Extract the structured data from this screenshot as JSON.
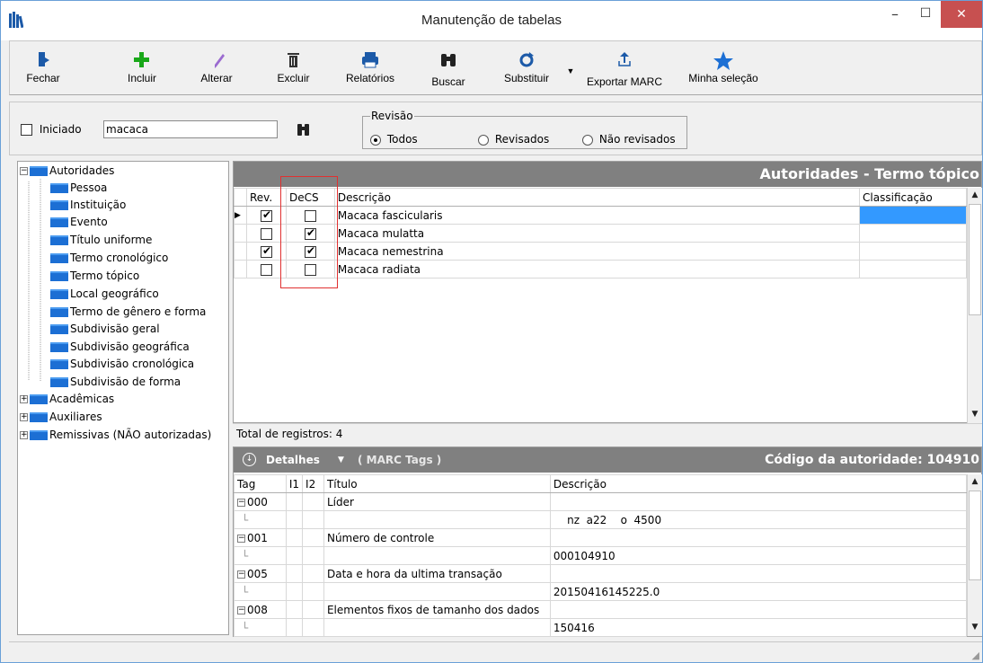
{
  "window": {
    "title": "Manutenção de tabelas",
    "minimize": "–",
    "maximize": "☐",
    "close": "✕"
  },
  "toolbar": {
    "buttons": [
      {
        "label": "Fechar",
        "icon": "door-exit-icon"
      },
      {
        "label": "Incluir",
        "icon": "plus-icon"
      },
      {
        "label": "Alterar",
        "icon": "pencil-icon"
      },
      {
        "label": "Excluir",
        "icon": "trash-icon"
      },
      {
        "label": "Relatórios",
        "icon": "printer-icon"
      },
      {
        "label": "Buscar",
        "icon": "binoculars-icon"
      },
      {
        "label": "Substituir",
        "icon": "refresh-icon"
      },
      {
        "label": "Exportar MARC",
        "icon": "upload-icon"
      },
      {
        "label": "Minha seleção",
        "icon": "star-icon"
      }
    ]
  },
  "filter": {
    "checkbox_label": "Iniciado",
    "search_value": "macaca",
    "revision_group": "Revisão",
    "revision_options": [
      "Todos",
      "Revisados",
      "Não revisados"
    ]
  },
  "tree": {
    "items": [
      {
        "label": "Autoridades"
      },
      {
        "label": "Pessoa"
      },
      {
        "label": "Instituição"
      },
      {
        "label": "Evento"
      },
      {
        "label": "Título uniforme"
      },
      {
        "label": "Termo cronológico"
      },
      {
        "label": "Termo tópico"
      },
      {
        "label": "Local geográfico"
      },
      {
        "label": "Termo de gênero e forma"
      },
      {
        "label": "Subdivisão geral"
      },
      {
        "label": "Subdivisão geográfica"
      },
      {
        "label": "Subdivisão cronológica"
      },
      {
        "label": "Subdivisão de forma"
      },
      {
        "label": "Acadêmicas"
      },
      {
        "label": "Auxiliares"
      },
      {
        "label": "Remissivas (NÃO autorizadas)"
      }
    ]
  },
  "grid": {
    "heading": "Autoridades - Termo tópico",
    "columns": [
      "Rev.",
      "DeCS",
      "Descrição",
      "Classificação"
    ],
    "rows": [
      {
        "rev": true,
        "decs": false,
        "descricao": "Macaca fascicularis"
      },
      {
        "rev": false,
        "decs": true,
        "descricao": "Macaca mulatta"
      },
      {
        "rev": true,
        "decs": true,
        "descricao": "Macaca nemestrina"
      },
      {
        "rev": false,
        "decs": false,
        "descricao": "Macaca radiata"
      }
    ],
    "total": "Total de registros: 4"
  },
  "details": {
    "toggle_label": "Detalhes",
    "dropdown_label": "( MARC Tags )",
    "code": "Código da autoridade: 104910",
    "columns": [
      "Tag",
      "I1",
      "I2",
      "Título",
      "Descrição"
    ],
    "rows": [
      {
        "tag": "000",
        "titulo": "Líder",
        "descricao": "    nz  a22    o  4500"
      },
      {
        "tag": "001",
        "titulo": "Número de controle",
        "descricao": "000104910"
      },
      {
        "tag": "005",
        "titulo": "Data e hora da ultima transação",
        "descricao": "20150416145225.0"
      },
      {
        "tag": "008",
        "titulo": "Elementos fixos de tamanho dos dados",
        "descricao": "150416"
      }
    ]
  },
  "colors": {
    "accent": "#1c6fd4",
    "header_gray": "#808080",
    "close_red": "#c75050",
    "highlight_box": "#e03030",
    "selected_cell": "#3399ff"
  }
}
